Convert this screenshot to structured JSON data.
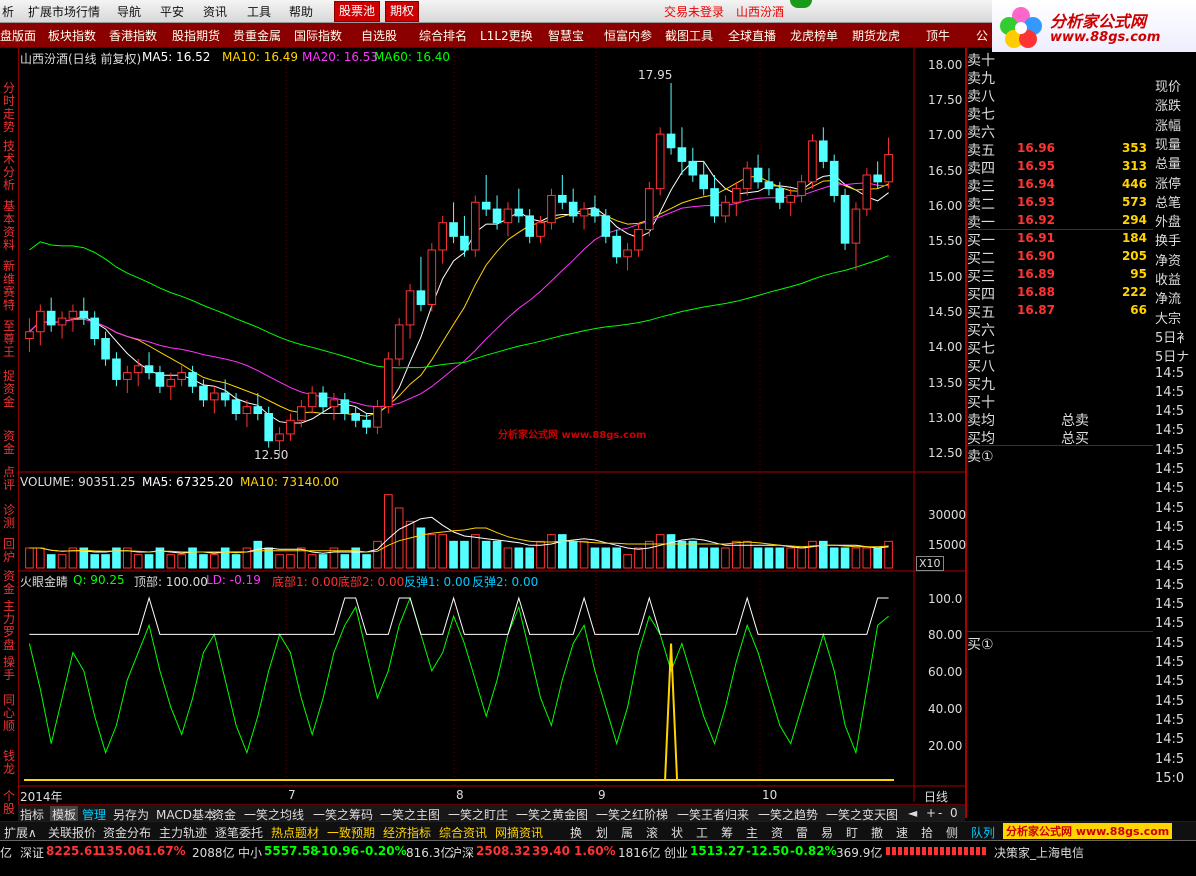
{
  "menubar": {
    "items": [
      "析",
      "扩展市场行情",
      "导航",
      "平安",
      "资讯",
      "工具",
      "帮助"
    ],
    "highlight": [
      "股票池",
      "期权"
    ],
    "status": "交易未登录",
    "stock_name": "山西汾酒"
  },
  "logo": {
    "title": "分析家公式网",
    "url": "www.88gs.com"
  },
  "toolbar": [
    "盘版面",
    "板块指数",
    "香港指数",
    "股指期货",
    "贵重金属",
    "国际指数",
    "自选股",
    "综合排名",
    "L1L2更换",
    "智慧宝",
    "恒富内参",
    "截图工具",
    "全球直播",
    "龙虎榜单",
    "期货龙虎",
    "顶牛",
    "公"
  ],
  "sidebar": [
    "分时走势",
    "技术分析",
    "基本资料",
    "新维赛特",
    "至尊王",
    "捉资金",
    "资金",
    "点评",
    "诊测",
    "回炉",
    "资金",
    "主力罗盘",
    "操手",
    "同心顺",
    "钱龙",
    "个股"
  ],
  "main_chart": {
    "title": "山西汾酒(日线 前复权)",
    "ma5": "MA5: 16.52",
    "ma10": "MA10: 16.49",
    "ma20": "MA20: 16.53",
    "ma60": "MA60: 16.40",
    "high_label": "17.95",
    "low_label": "12.50",
    "watermark": "分析家公式网 www.88gs.com",
    "yaxis": [
      "18.00",
      "17.50",
      "17.00",
      "16.50",
      "16.00",
      "15.50",
      "15.00",
      "14.50",
      "14.00",
      "13.50",
      "13.00",
      "12.50"
    ]
  },
  "volume_chart": {
    "volume": "VOLUME: 90351.25",
    "ma5": "MA5: 67325.20",
    "ma10": "MA10: 73140.00",
    "yaxis": [
      "30000",
      "15000"
    ],
    "unit": "X10"
  },
  "indicator": {
    "name": "火眼金睛",
    "q": "Q: 90.25",
    "top": "顶部: 100.00",
    "ld": "LD: -0.19",
    "bottom1": "底部1: 0.00",
    "bottom2": "底部2: 0.00",
    "rebound1": "反弹1: 0.00",
    "rebound2": "反弹2: 0.00",
    "yaxis": [
      "100.0",
      "80.00",
      "60.00",
      "40.00",
      "20.00"
    ]
  },
  "xaxis": {
    "labels": [
      "2014年",
      "7",
      "8",
      "9",
      "10"
    ],
    "period": "日线"
  },
  "chart_data": {
    "type": "candlestick",
    "title": "山西汾酒(日线 前复权)",
    "ylim": [
      12.3,
      18.2
    ],
    "points": [
      [
        14.2,
        14.5,
        14.0,
        14.3
      ],
      [
        14.3,
        14.7,
        14.1,
        14.6
      ],
      [
        14.6,
        14.8,
        14.3,
        14.4
      ],
      [
        14.4,
        14.6,
        14.2,
        14.5
      ],
      [
        14.5,
        14.7,
        14.3,
        14.6
      ],
      [
        14.6,
        14.8,
        14.4,
        14.5
      ],
      [
        14.5,
        14.6,
        14.1,
        14.2
      ],
      [
        14.2,
        14.3,
        13.8,
        13.9
      ],
      [
        13.9,
        14.0,
        13.5,
        13.6
      ],
      [
        13.6,
        13.8,
        13.4,
        13.7
      ],
      [
        13.7,
        13.9,
        13.5,
        13.8
      ],
      [
        13.8,
        14.0,
        13.6,
        13.7
      ],
      [
        13.7,
        13.8,
        13.4,
        13.5
      ],
      [
        13.5,
        13.7,
        13.3,
        13.6
      ],
      [
        13.6,
        13.8,
        13.5,
        13.7
      ],
      [
        13.7,
        13.8,
        13.4,
        13.5
      ],
      [
        13.5,
        13.6,
        13.2,
        13.3
      ],
      [
        13.3,
        13.5,
        13.1,
        13.4
      ],
      [
        13.4,
        13.6,
        13.2,
        13.3
      ],
      [
        13.3,
        13.4,
        13.0,
        13.1
      ],
      [
        13.1,
        13.3,
        12.9,
        13.2
      ],
      [
        13.2,
        13.4,
        13.0,
        13.1
      ],
      [
        13.1,
        13.2,
        12.6,
        12.7
      ],
      [
        12.7,
        12.9,
        12.5,
        12.8
      ],
      [
        12.8,
        13.1,
        12.7,
        13.0
      ],
      [
        13.0,
        13.3,
        12.9,
        13.2
      ],
      [
        13.2,
        13.5,
        13.1,
        13.4
      ],
      [
        13.4,
        13.5,
        13.1,
        13.2
      ],
      [
        13.2,
        13.4,
        13.0,
        13.3
      ],
      [
        13.3,
        13.4,
        13.0,
        13.1
      ],
      [
        13.1,
        13.2,
        12.9,
        13.0
      ],
      [
        13.0,
        13.1,
        12.8,
        12.9
      ],
      [
        12.9,
        13.3,
        12.8,
        13.2
      ],
      [
        13.2,
        14.0,
        13.1,
        13.9
      ],
      [
        13.9,
        14.5,
        13.8,
        14.4
      ],
      [
        14.4,
        15.0,
        14.2,
        14.9
      ],
      [
        14.9,
        15.4,
        14.6,
        14.7
      ],
      [
        14.7,
        15.6,
        14.6,
        15.5
      ],
      [
        15.5,
        16.0,
        15.3,
        15.9
      ],
      [
        15.9,
        16.2,
        15.6,
        15.7
      ],
      [
        15.7,
        16.0,
        15.4,
        15.5
      ],
      [
        15.5,
        16.3,
        15.4,
        16.2
      ],
      [
        16.2,
        16.6,
        16.0,
        16.1
      ],
      [
        16.1,
        16.3,
        15.8,
        15.9
      ],
      [
        15.9,
        16.2,
        15.7,
        16.1
      ],
      [
        16.1,
        16.4,
        15.9,
        16.0
      ],
      [
        16.0,
        16.1,
        15.6,
        15.7
      ],
      [
        15.7,
        16.0,
        15.6,
        15.9
      ],
      [
        15.9,
        16.4,
        15.8,
        16.3
      ],
      [
        16.3,
        16.6,
        16.1,
        16.2
      ],
      [
        16.2,
        16.4,
        15.9,
        16.0
      ],
      [
        16.0,
        16.2,
        15.8,
        16.1
      ],
      [
        16.1,
        16.3,
        15.9,
        16.0
      ],
      [
        16.0,
        16.1,
        15.6,
        15.7
      ],
      [
        15.7,
        15.8,
        15.3,
        15.4
      ],
      [
        15.4,
        15.6,
        15.2,
        15.5
      ],
      [
        15.5,
        15.9,
        15.4,
        15.8
      ],
      [
        15.8,
        16.5,
        15.7,
        16.4
      ],
      [
        16.4,
        17.3,
        16.3,
        17.2
      ],
      [
        17.2,
        17.95,
        16.9,
        17.0
      ],
      [
        17.0,
        17.3,
        16.6,
        16.8
      ],
      [
        16.8,
        17.0,
        16.5,
        16.6
      ],
      [
        16.6,
        16.8,
        16.3,
        16.4
      ],
      [
        16.4,
        16.6,
        15.9,
        16.0
      ],
      [
        16.0,
        16.3,
        15.9,
        16.2
      ],
      [
        16.2,
        16.5,
        16.0,
        16.4
      ],
      [
        16.4,
        16.8,
        16.3,
        16.7
      ],
      [
        16.7,
        16.9,
        16.4,
        16.5
      ],
      [
        16.5,
        16.7,
        16.3,
        16.4
      ],
      [
        16.4,
        16.5,
        16.1,
        16.2
      ],
      [
        16.2,
        16.4,
        16.0,
        16.3
      ],
      [
        16.3,
        16.6,
        16.2,
        16.5
      ],
      [
        16.5,
        17.2,
        16.4,
        17.1
      ],
      [
        17.1,
        17.3,
        16.7,
        16.8
      ],
      [
        16.8,
        16.9,
        16.2,
        16.3
      ],
      [
        16.3,
        16.4,
        15.5,
        15.6
      ],
      [
        15.6,
        16.2,
        15.2,
        16.1
      ],
      [
        16.1,
        16.7,
        16.0,
        16.6
      ],
      [
        16.6,
        16.8,
        16.4,
        16.5
      ],
      [
        16.5,
        17.15,
        16.4,
        16.9
      ]
    ],
    "ma_series": [
      {
        "name": "MA5",
        "color": "#ffffff"
      },
      {
        "name": "MA10",
        "color": "#ffd400"
      },
      {
        "name": "MA20",
        "color": "#ff33ff"
      },
      {
        "name": "MA60",
        "color": "#00ff00"
      }
    ],
    "volume": [
      3,
      3,
      2,
      2,
      3,
      3,
      2,
      2,
      3,
      3,
      2,
      2,
      3,
      2,
      2,
      3,
      2,
      2,
      3,
      2,
      3,
      4,
      3,
      2,
      2,
      3,
      2,
      2,
      3,
      2,
      3,
      2,
      4,
      11,
      9,
      7,
      6,
      5,
      5,
      4,
      4,
      5,
      4,
      4,
      3,
      3,
      3,
      4,
      5,
      5,
      4,
      4,
      3,
      3,
      3,
      2,
      3,
      4,
      5,
      5,
      4,
      4,
      3,
      3,
      3,
      4,
      4,
      3,
      3,
      3,
      3,
      3,
      4,
      4,
      3,
      3,
      3,
      3,
      3,
      4
    ],
    "indicator": [
      75,
      50,
      20,
      45,
      70,
      60,
      35,
      15,
      30,
      55,
      70,
      85,
      60,
      40,
      25,
      45,
      70,
      80,
      55,
      30,
      15,
      35,
      60,
      80,
      70,
      45,
      25,
      45,
      70,
      85,
      95,
      70,
      45,
      60,
      85,
      100,
      80,
      60,
      70,
      90,
      75,
      55,
      35,
      55,
      80,
      95,
      70,
      45,
      30,
      55,
      75,
      85,
      60,
      40,
      20,
      40,
      70,
      90,
      80,
      60,
      75,
      55,
      35,
      20,
      40,
      65,
      85,
      70,
      50,
      30,
      20,
      40,
      60,
      80,
      60,
      30,
      15,
      50,
      85,
      90
    ]
  },
  "quote": {
    "rows": [
      {
        "label": "卖十",
        "price": "",
        "vol": ""
      },
      {
        "label": "卖九",
        "price": "",
        "vol": ""
      },
      {
        "label": "卖八",
        "price": "",
        "vol": ""
      },
      {
        "label": "卖七",
        "price": "",
        "vol": ""
      },
      {
        "label": "卖六",
        "price": "",
        "vol": ""
      },
      {
        "label": "卖五",
        "price": "16.96",
        "vol": "353"
      },
      {
        "label": "卖四",
        "price": "16.95",
        "vol": "313"
      },
      {
        "label": "卖三",
        "price": "16.94",
        "vol": "446"
      },
      {
        "label": "卖二",
        "price": "16.93",
        "vol": "573"
      },
      {
        "label": "卖一",
        "price": "16.92",
        "vol": "294"
      },
      {
        "label": "买一",
        "price": "16.91",
        "vol": "184"
      },
      {
        "label": "买二",
        "price": "16.90",
        "vol": "205"
      },
      {
        "label": "买三",
        "price": "16.89",
        "vol": "95"
      },
      {
        "label": "买四",
        "price": "16.88",
        "vol": "222"
      },
      {
        "label": "买五",
        "price": "16.87",
        "vol": "66"
      },
      {
        "label": "买六",
        "price": "",
        "vol": ""
      },
      {
        "label": "买七",
        "price": "",
        "vol": ""
      },
      {
        "label": "买八",
        "price": "",
        "vol": ""
      },
      {
        "label": "买九",
        "price": "",
        "vol": ""
      },
      {
        "label": "买十",
        "price": "",
        "vol": ""
      }
    ],
    "avg_sell": "卖均",
    "avg_buy": "买均",
    "total_sell": "总卖",
    "total_buy": "总买",
    "sell1": "卖①",
    "buy1": "买①"
  },
  "rightcol": [
    "现价",
    "涨跌",
    "涨幅",
    "现量",
    "总量",
    "涨停",
    "总笔",
    "外盘",
    "换手",
    "净资",
    "收益",
    "净流",
    "大宗",
    "5日衤",
    "5日ナ",
    "14:5",
    "14:5",
    "14:5",
    "14:5",
    "14:5",
    "14:5",
    "14:5",
    "14:5",
    "14:5",
    "14:5",
    "14:5",
    "14:5",
    "14:5",
    "14:5",
    "14:5",
    "14:5",
    "14:5",
    "14:5",
    "14:5",
    "14:5",
    "14:5",
    "15:0"
  ],
  "tabs1": [
    "指标",
    "模板",
    "管理",
    "另存为",
    "MACD基本",
    "资金",
    "一笑之均线",
    "一笑之筹码",
    "一笑之主图",
    "一笑之盯庄",
    "一笑之黄金图",
    "一笑之红阶梯",
    "一笑王者归来",
    "一笑之趋势",
    "一笑之变天图"
  ],
  "tabs2": [
    "扩展∧",
    "关联报价",
    "资金分布",
    "主力轨迹",
    "逐笔委托",
    "热点题材",
    "一致预期",
    "经济指标",
    "综合资讯",
    "网摘资讯",
    "换",
    "划",
    "属",
    "滚",
    "状",
    "工",
    "筹",
    "主",
    "资",
    "雷",
    "易",
    "盯",
    "撤",
    "速",
    "拾",
    "侧",
    "队列"
  ],
  "statusbar": {
    "s0": "亿",
    "shenzheng_name": "深证",
    "shenzheng_val": "8225.61",
    "shenzheng_chg": "135.06",
    "shenzheng_pct": "1.67%",
    "shenzheng_amt": "2088亿",
    "zx_name": "中小",
    "zx_val": "5557.58",
    "zx_chg": "-10.96",
    "zx_pct": "-0.20%",
    "zx_amt": "816.3亿",
    "hs_name": "沪深",
    "hs_val": "2508.32",
    "hs_chg": "39.40",
    "hs_pct": "1.60%",
    "hs_amt": "1816亿",
    "cy_name": "创业",
    "cy_val": "1513.27",
    "cy_chg": "-12.50",
    "cy_pct": "-0.82%",
    "cy_amt": "369.9亿",
    "broker": "决策家_上海电信"
  }
}
